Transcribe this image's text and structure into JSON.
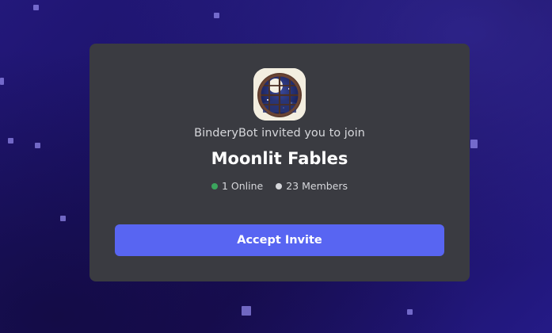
{
  "invite": {
    "inviter_text": "BinderyBot invited you to join",
    "server_name": "Moonlit Fables",
    "online_count": "1 Online",
    "member_count": "23 Members",
    "accept_label": "Accept Invite"
  },
  "colors": {
    "online_dot": "#3ba55d",
    "members_dot": "#d6d7db",
    "accent": "#5865f2",
    "card_bg": "#3a3b41"
  },
  "icons": {
    "server_avatar": "moonlit-window-icon"
  }
}
